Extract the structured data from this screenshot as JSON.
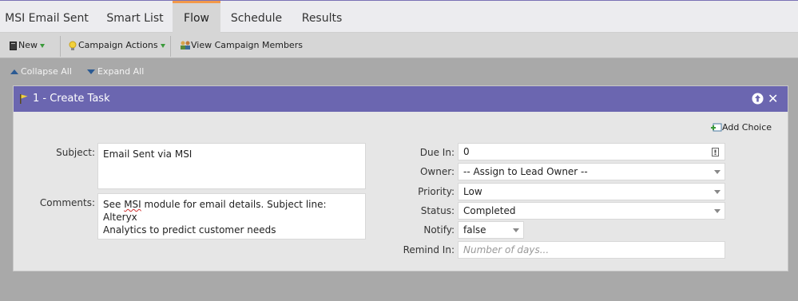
{
  "tabs": [
    {
      "label": "MSI Email Sent",
      "active": false
    },
    {
      "label": "Smart List",
      "active": false
    },
    {
      "label": "Flow",
      "active": true
    },
    {
      "label": "Schedule",
      "active": false
    },
    {
      "label": "Results",
      "active": false
    }
  ],
  "toolbar": {
    "new_label": "New",
    "campaign_actions_label": "Campaign Actions",
    "view_members_label": "View Campaign Members"
  },
  "flow_controls": {
    "collapse_all": "Collapse All",
    "expand_all": "Expand All"
  },
  "step": {
    "title": "1 - Create Task",
    "add_choice_label": "Add Choice",
    "subject_label": "Subject:",
    "subject_value": "Email Sent via MSI",
    "comments_label": "Comments:",
    "comments_pre": "See ",
    "comments_misspelled": "MSI",
    "comments_line1_post": " module for email details. Subject line: Alteryx",
    "comments_line2": "Analytics to predict customer needs",
    "due_in_label": "Due In:",
    "due_in_value": "0",
    "owner_label": "Owner:",
    "owner_value": "-- Assign to Lead Owner --",
    "priority_label": "Priority:",
    "priority_value": "Low",
    "status_label": "Status:",
    "status_value": "Completed",
    "notify_label": "Notify:",
    "notify_value": "false",
    "remind_in_label": "Remind In:",
    "remind_in_placeholder": "Number of days..."
  },
  "colors": {
    "step_header": "#6b66b0",
    "active_tab_accent": "#f2994a",
    "page_background": "#a9a9a9"
  },
  "icons": [
    "new-doc-icon",
    "lightbulb-icon",
    "campaign-members-icon",
    "collapse-arrow-icon",
    "expand-arrow-icon",
    "flag-icon",
    "move-up-icon",
    "close-icon",
    "add-choice-icon",
    "calendar-icon"
  ]
}
